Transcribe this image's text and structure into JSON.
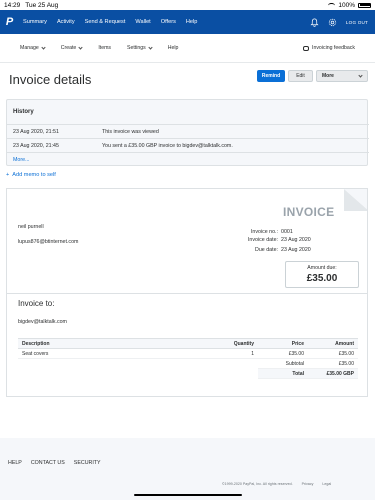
{
  "status_bar": {
    "time": "14:29",
    "date": "Tue 25 Aug",
    "battery": "100%"
  },
  "top_nav": {
    "links": [
      "Summary",
      "Activity",
      "Send & Request",
      "Wallet",
      "Offers",
      "Help"
    ],
    "logout": "LOG OUT",
    "brand_color": "#0a4fa3"
  },
  "sub_nav": {
    "items": [
      {
        "label": "Manage",
        "dropdown": true
      },
      {
        "label": "Create",
        "dropdown": true
      },
      {
        "label": "Items",
        "dropdown": false
      },
      {
        "label": "Settings",
        "dropdown": true
      },
      {
        "label": "Help",
        "dropdown": false
      }
    ],
    "feedback": "Invoicing feedback"
  },
  "page": {
    "title": "Invoice details",
    "remind": "Remind",
    "edit": "Edit",
    "more": "More"
  },
  "history": {
    "title": "History",
    "rows": [
      {
        "date": "23 Aug 2020, 21:51",
        "event": "This invoice was viewed"
      },
      {
        "date": "23 Aug 2020, 21:45",
        "event": "You sent a £35.00 GBP invoice to bigdev@talktalk.com."
      }
    ],
    "more": "More..."
  },
  "memo": "Add memo to self",
  "invoice": {
    "heading": "INVOICE",
    "from_name": "neil purnell",
    "from_email": "lupus876@btinternet.com",
    "meta": [
      {
        "label": "Invoice no.:",
        "value": "0001"
      },
      {
        "label": "Invoice date:",
        "value": "23 Aug 2020"
      },
      {
        "label": "Due date:",
        "value": "23 Aug 2020"
      }
    ],
    "amount_due_label": "Amount due:",
    "amount_due": "£35.00",
    "to_title": "Invoice to:",
    "to_email": "bigdev@talktalk.com",
    "table": {
      "headers": [
        "Description",
        "Quantity",
        "Price",
        "Amount"
      ],
      "rows": [
        {
          "description": "Seat covers",
          "quantity": "1",
          "price": "£35.00",
          "amount": "£35.00"
        }
      ],
      "subtotal_label": "Subtotal",
      "subtotal": "£35.00",
      "total_label": "Total",
      "total": "£35.00 GBP"
    }
  },
  "footer": {
    "links": [
      "HELP",
      "CONTACT US",
      "SECURITY"
    ],
    "copyright": "©1999-2020 PayPal, Inc. All rights reserved.",
    "privacy": "Privacy",
    "legal": "Legal"
  }
}
